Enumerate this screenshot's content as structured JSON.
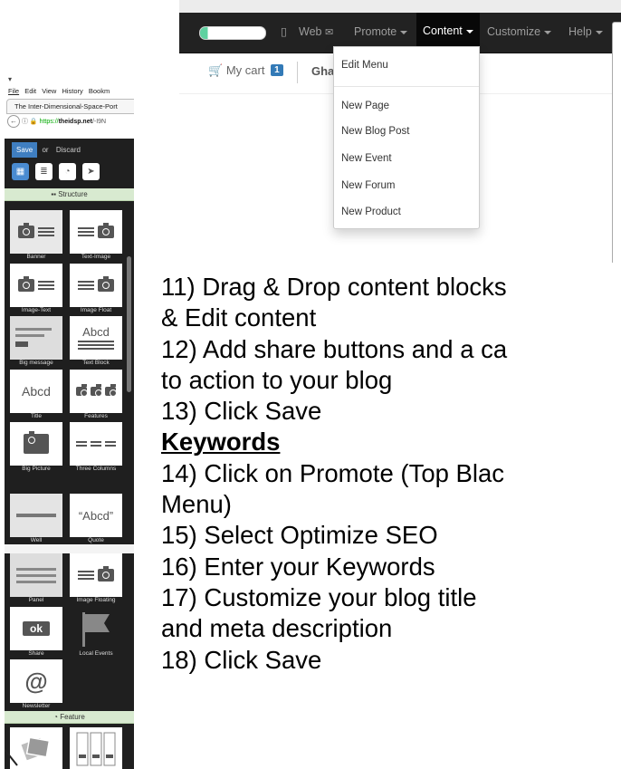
{
  "navbar": {
    "items": [
      {
        "label": "Web"
      },
      {
        "label": "Promote"
      },
      {
        "label": "Content"
      },
      {
        "label": "Customize"
      },
      {
        "label": "Help"
      }
    ],
    "cart_label": "My cart",
    "cart_count": "1",
    "site_name_fragment": "Gha",
    "dropdown": {
      "edit": "Edit Menu",
      "items": [
        "New Page",
        "New Blog Post",
        "New Event",
        "New Forum",
        "New Product"
      ]
    }
  },
  "browser": {
    "menubar": [
      "File",
      "Edit",
      "View",
      "History",
      "Bookm"
    ],
    "tab_title": "The Inter-Dimensional-Space-Port",
    "url_scheme": "https://",
    "url_host": "theidsp.net",
    "url_rest": "/-I9N",
    "save_label": "Save",
    "or_label": "or",
    "discard_label": "Discard",
    "structure_header": "Structure",
    "feature_header": "Feature",
    "blocks": [
      {
        "label": "Banner"
      },
      {
        "label": "Text-Image"
      },
      {
        "label": "Image-Text"
      },
      {
        "label": "Image Float"
      },
      {
        "label": "Big message"
      },
      {
        "label": "Text Block"
      },
      {
        "label": "Title"
      },
      {
        "label": "Features"
      },
      {
        "label": "Big Picture"
      },
      {
        "label": "Three Columns"
      },
      {
        "label": "Well"
      },
      {
        "label": "Quote"
      },
      {
        "label": "Panel"
      },
      {
        "label": "Image Floating"
      },
      {
        "label": "Share"
      },
      {
        "label": "Local Events"
      },
      {
        "label": "Newsletter"
      }
    ],
    "thumb_text": {
      "abcd": "Abcd",
      "quote": "“Abcd”",
      "ok": "ok",
      "at": "@"
    }
  },
  "instructions": {
    "lines": [
      "11) Drag & Drop content blocks",
      "& Edit content",
      "12) Add share buttons and a ca",
      "to action to your blog",
      "13) Click Save",
      "Keywords",
      "14) Click on Promote (Top Blac",
      "Menu)",
      "15) Select Optimize SEO",
      "16) Enter your Keywords",
      "17) Customize your blog title",
      "and meta description",
      "18) Click Save"
    ]
  },
  "colors": {
    "navbar_bg": "#222222",
    "active_nav_bg": "#080808",
    "builder_bg": "#1f1f1f",
    "section_header_bg": "#d8ead0",
    "save_button": "#3f7ec0",
    "cart_badge": "#337ab7"
  }
}
